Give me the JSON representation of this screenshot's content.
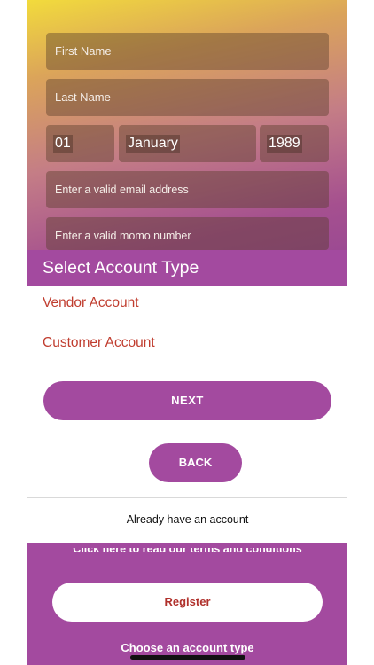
{
  "form": {
    "first_name_placeholder": "First Name",
    "last_name_placeholder": "Last Name",
    "dob_day": "01",
    "dob_month": "January",
    "dob_year": "1989",
    "email_placeholder": "Enter a valid email address",
    "momo_placeholder": "Enter a valid momo number"
  },
  "account_sheet": {
    "title": "Select Account Type",
    "options": [
      {
        "label": "Vendor Account"
      },
      {
        "label": "Customer Account"
      }
    ]
  },
  "actions": {
    "next_label": "NEXT",
    "back_label": "BACK",
    "already_label": "Already have an account"
  },
  "footer": {
    "terms_label": "Click here to read our terms and conditions",
    "register_label": "Register",
    "choose_label": "Choose an account type"
  },
  "colors": {
    "accent": "#a34a9f",
    "option_text": "#c03c2e",
    "register_text": "#b0312c"
  }
}
